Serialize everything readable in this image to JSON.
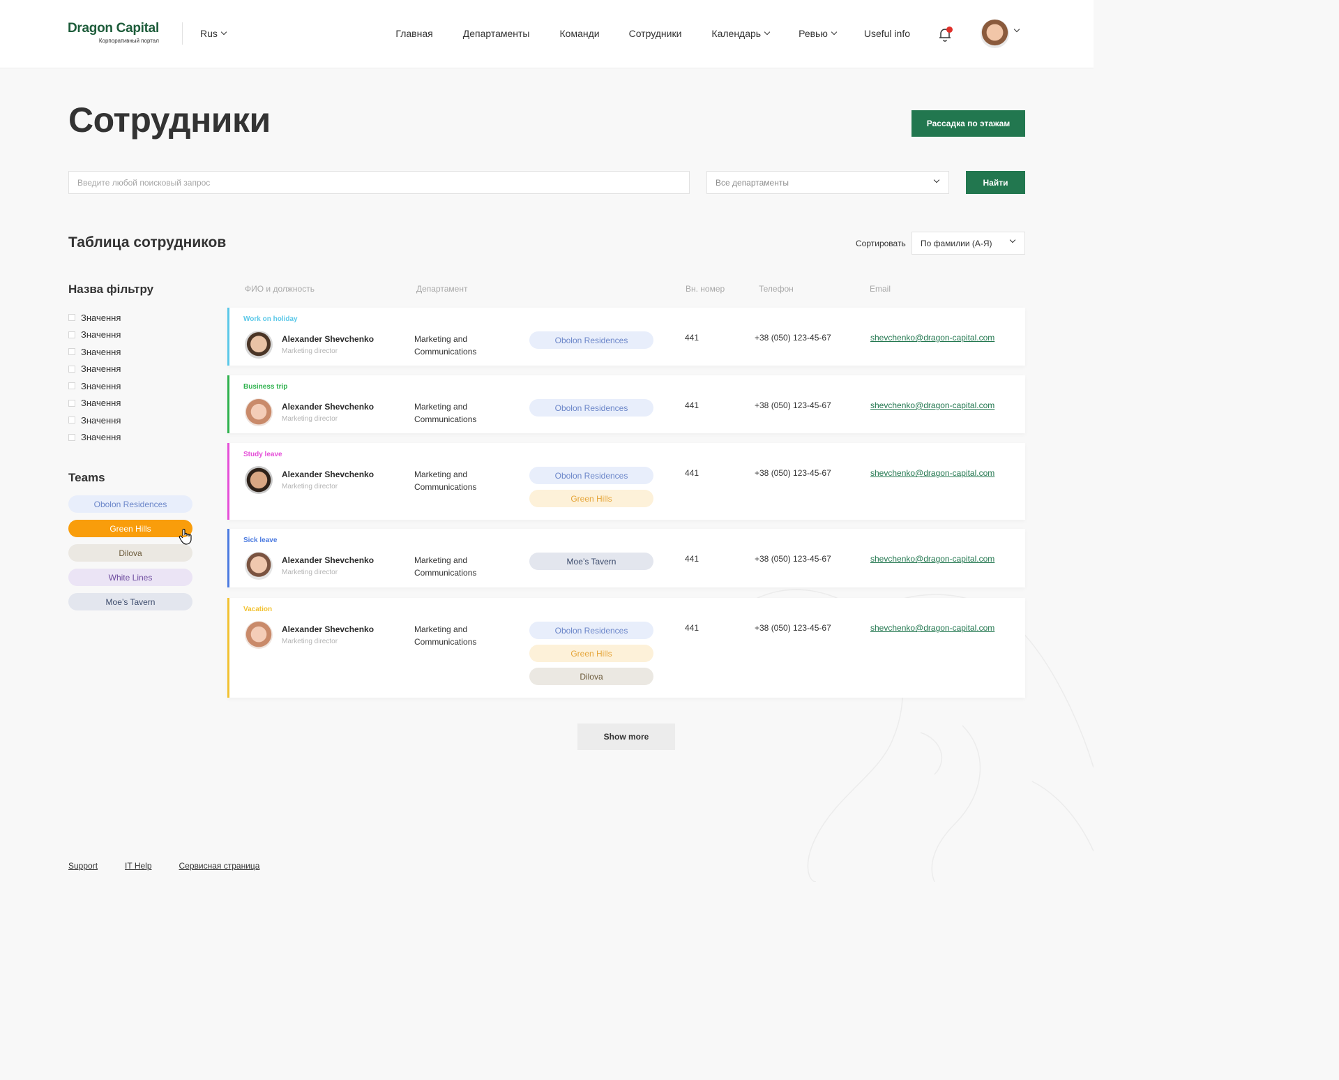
{
  "header": {
    "logo_title": "Dragon Capital",
    "logo_subtitle": "Корпоративный портал",
    "language": "Rus",
    "nav": [
      {
        "label": "Главная",
        "dropdown": false
      },
      {
        "label": "Департаменты",
        "dropdown": false
      },
      {
        "label": "Команди",
        "dropdown": false
      },
      {
        "label": "Сотрудники",
        "dropdown": false
      },
      {
        "label": "Календарь",
        "dropdown": true
      },
      {
        "label": "Ревью",
        "dropdown": true
      },
      {
        "label": "Useful info",
        "dropdown": false
      }
    ],
    "notification_dot_color": "#e0302a"
  },
  "page": {
    "title": "Сотрудники",
    "floors_button": "Рассадка по этажам"
  },
  "search": {
    "placeholder": "Введите любой поисковый запрос",
    "value": "",
    "department_select": "Все департаменты",
    "find_button": "Найти"
  },
  "table": {
    "title": "Таблица сотрудников",
    "sort_label": "Сортировать",
    "sort_value": "По фамилии (А-Я)",
    "columns": {
      "name": "ФИО и должность",
      "department": "Департамент",
      "ext": "Вн. номер",
      "phone": "Телефон",
      "email": "Email"
    },
    "rows": [
      {
        "status": "Work on holiday",
        "status_color": "#5bc8e8",
        "name": "Alexander Shevchenko",
        "position": "Marketing director",
        "department": "Marketing and Communications",
        "teams": [
          "Obolon Residences"
        ],
        "ext": "441",
        "phone": "+38 (050) 123-45-67",
        "email": "shevchenko@dragon-capital.com",
        "avatar": "male-1"
      },
      {
        "status": "Business trip",
        "status_color": "#2fb24e",
        "name": "Alexander Shevchenko",
        "position": "Marketing director",
        "department": "Marketing and Communications",
        "teams": [
          "Obolon Residences"
        ],
        "ext": "441",
        "phone": "+38 (050) 123-45-67",
        "email": "shevchenko@dragon-capital.com",
        "avatar": "female-1"
      },
      {
        "status": "Study leave",
        "status_color": "#e54fd8",
        "name": "Alexander Shevchenko",
        "position": "Marketing director",
        "department": "Marketing and Communications",
        "teams": [
          "Obolon Residences",
          "Green Hills"
        ],
        "ext": "441",
        "phone": "+38 (050) 123-45-67",
        "email": "shevchenko@dragon-capital.com",
        "avatar": "male-2"
      },
      {
        "status": "Sick leave",
        "status_color": "#4c7be0",
        "name": "Alexander Shevchenko",
        "position": "Marketing director",
        "department": "Marketing and Communications",
        "teams": [
          "Moe’s Tavern"
        ],
        "ext": "441",
        "phone": "+38 (050) 123-45-67",
        "email": "shevchenko@dragon-capital.com",
        "avatar": "female-2"
      },
      {
        "status": "Vacation",
        "status_color": "#f2c232",
        "name": "Alexander Shevchenko",
        "position": "Marketing director",
        "department": "Marketing and Communications",
        "teams": [
          "Obolon Residences",
          "Green Hills",
          "Dilova"
        ],
        "ext": "441",
        "phone": "+38 (050) 123-45-67",
        "email": "shevchenko@dragon-capital.com",
        "avatar": "female-1"
      }
    ],
    "show_more": "Show more"
  },
  "filters": {
    "title": "Назва фільтру",
    "items": [
      "Значення",
      "Значення",
      "Значення",
      "Значення",
      "Значення",
      "Значення",
      "Значення",
      "Значення"
    ]
  },
  "teams": {
    "title": "Teams",
    "items": [
      {
        "label": "Obolon Residences",
        "active": false
      },
      {
        "label": "Green Hills",
        "active": true
      },
      {
        "label": "Dilova",
        "active": false
      },
      {
        "label": "White Lines",
        "active": false
      },
      {
        "label": "Moe’s Tavern",
        "active": false
      }
    ]
  },
  "team_colors": {
    "Obolon Residences": {
      "bg": "#e8eefb",
      "fg": "#6b86c9"
    },
    "Green Hills": {
      "bg": "#fdf1d9",
      "fg": "#e5a53a"
    },
    "Green Hills active": {
      "bg": "#f99d0b",
      "fg": "#ffffff"
    },
    "Dilova": {
      "bg": "#ebe8e2",
      "fg": "#6b5a3a"
    },
    "White Lines": {
      "bg": "#ebe4f5",
      "fg": "#6d4a9e"
    },
    "Moe’s Tavern": {
      "bg": "#e3e6ee",
      "fg": "#3b4a6b"
    }
  },
  "footer": [
    "Support",
    "IT Help",
    "Сервисная страница"
  ]
}
